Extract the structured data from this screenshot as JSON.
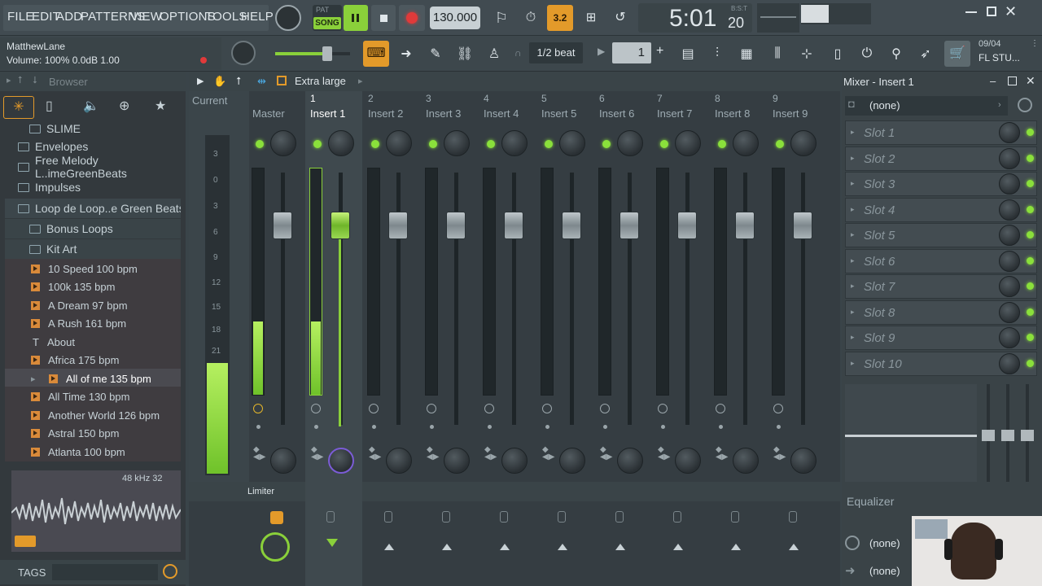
{
  "menu": [
    "FILE",
    "EDIT",
    "ADD",
    "PATTERNS",
    "VIEW",
    "OPTIONS",
    "TOOLS",
    "HELP"
  ],
  "transport": {
    "pat": "PAT",
    "song": "SONG",
    "tempo": "130.000",
    "time": "5:01",
    "time_frac": "20",
    "bst": "B:S:T",
    "counter": "3.2"
  },
  "hint": {
    "user": "MatthewLane",
    "line": "Volume: 100%  0.0dB  1.00"
  },
  "snap": {
    "value": "1/2 beat",
    "pattern": "1"
  },
  "news": {
    "date": "09/04",
    "text": "FL STU..."
  },
  "browser": {
    "title": "Browser",
    "size_label": "Extra large",
    "items": [
      {
        "type": "folder",
        "label": "SLIME"
      },
      {
        "type": "folder",
        "label": "Envelopes"
      },
      {
        "type": "folder",
        "label": "Free Melody L..imeGreenBeats"
      },
      {
        "type": "folder",
        "label": "Impulses"
      },
      {
        "type": "folder",
        "label": "Loop de Loop..e Green Beats"
      },
      {
        "type": "folder",
        "label": "Bonus Loops"
      },
      {
        "type": "folder",
        "label": "Kit Art"
      },
      {
        "type": "file",
        "label": "10 Speed 100 bpm"
      },
      {
        "type": "file",
        "label": "100k 135 bpm"
      },
      {
        "type": "file",
        "label": "A Dream 97 bpm"
      },
      {
        "type": "file",
        "label": "A Rush 161 bpm"
      },
      {
        "type": "text",
        "label": "About"
      },
      {
        "type": "file",
        "label": "Africa 175 bpm"
      },
      {
        "type": "file",
        "label": "All of me 135 bpm"
      },
      {
        "type": "file",
        "label": "All Time 130 bpm"
      },
      {
        "type": "file",
        "label": "Another World 126 bpm"
      },
      {
        "type": "file",
        "label": "Astral 150 bpm"
      },
      {
        "type": "file",
        "label": "Atlanta 100 bpm"
      }
    ],
    "sample_info": "48 kHz 32",
    "tags": "TAGS"
  },
  "mixer": {
    "current": "Current",
    "scale": [
      "3",
      "0",
      "3",
      "6",
      "9",
      "12",
      "15",
      "18",
      "21"
    ],
    "strips": [
      {
        "num": "",
        "label": "Master",
        "level": 0.32
      },
      {
        "num": "1",
        "label": "Insert 1",
        "level": 0.32
      },
      {
        "num": "2",
        "label": "Insert 2",
        "level": 0
      },
      {
        "num": "3",
        "label": "Insert 3",
        "level": 0
      },
      {
        "num": "4",
        "label": "Insert 4",
        "level": 0
      },
      {
        "num": "5",
        "label": "Insert 5",
        "level": 0
      },
      {
        "num": "6",
        "label": "Insert 6",
        "level": 0
      },
      {
        "num": "7",
        "label": "Insert 7",
        "level": 0
      },
      {
        "num": "8",
        "label": "Insert 8",
        "level": 0
      },
      {
        "num": "9",
        "label": "Insert 9",
        "level": 0
      }
    ],
    "limiter": "Limiter"
  },
  "insert_panel": {
    "title": "Mixer - Insert 1",
    "preset": "(none)",
    "slots": [
      "Slot 1",
      "Slot 2",
      "Slot 3",
      "Slot 4",
      "Slot 5",
      "Slot 6",
      "Slot 7",
      "Slot 8",
      "Slot 9",
      "Slot 10"
    ],
    "eq_label": "Equalizer",
    "in_route": "(none)",
    "out_route": "(none)"
  }
}
